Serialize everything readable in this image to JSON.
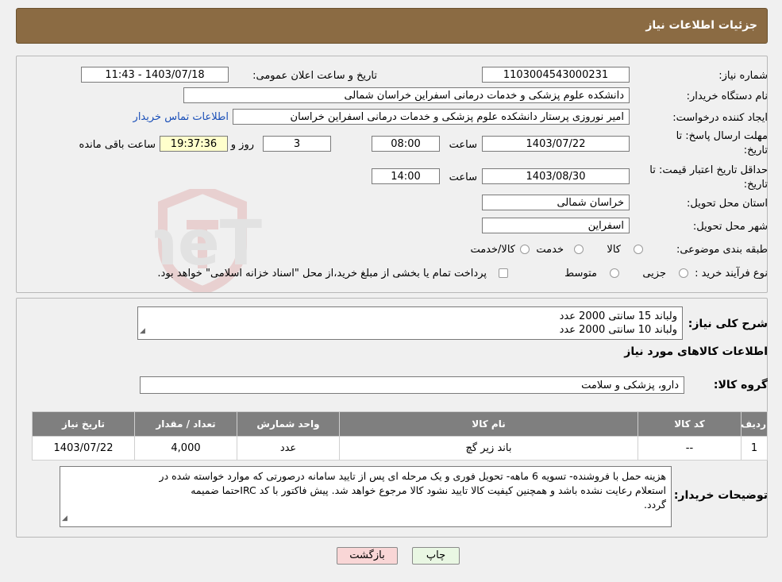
{
  "header": {
    "title": "جزئیات اطلاعات نیاز"
  },
  "need_number": {
    "label": "شماره نیاز:",
    "value": "1103004543000231"
  },
  "announce_datetime": {
    "label": "تاریخ و ساعت اعلان عمومی:",
    "value": "1403/07/18 - 11:43"
  },
  "buyer_org": {
    "label": "نام دستگاه خریدار:",
    "value": "دانشکده علوم پزشکی و خدمات درمانی اسفراین خراسان شمالی"
  },
  "requester": {
    "label": "ایجاد کننده درخواست:",
    "value": "امیر  نوروزی  پرستار  دانشکده علوم پزشکی و خدمات درمانی اسفراین خراسان",
    "contact_link": "اطلاعات تماس خریدار"
  },
  "reply_deadline": {
    "label_line1": "مهلت ارسال پاسخ: تا",
    "label_line2": "تاریخ:",
    "date": "1403/07/22",
    "time_label": "ساعت",
    "time": "08:00",
    "days": "3",
    "days_label": "روز و",
    "remaining": "19:37:36",
    "remaining_label": "ساعت باقی مانده"
  },
  "price_validity": {
    "label_line1": "حداقل تاریخ اعتبار قیمت: تا",
    "label_line2": "تاریخ:",
    "date": "1403/08/30",
    "time_label": "ساعت",
    "time": "14:00"
  },
  "delivery_province": {
    "label": "استان محل تحویل:",
    "value": "خراسان شمالی"
  },
  "delivery_city": {
    "label": "شهر محل تحویل:",
    "value": "اسفراین"
  },
  "category": {
    "label": "طبقه بندی موضوعی:",
    "options": [
      "کالا",
      "خدمت",
      "کالا/خدمت"
    ]
  },
  "purchase_type": {
    "label": "نوع فرآیند خرید :",
    "options": [
      "جزیی",
      "متوسط"
    ],
    "note": "پرداخت تمام یا بخشی از مبلغ خرید،از محل \"اسناد خزانه اسلامی\" خواهد بود."
  },
  "summary": {
    "label": "شرح کلی نیاز:",
    "lines": [
      "ولباند 15 سانتی 2000 عدد",
      "ولباند 10 سانتی 2000 عدد"
    ]
  },
  "goods_info_title": "اطلاعات کالاهای مورد نیاز",
  "goods_group": {
    "label": "گروه کالا:",
    "value": "دارو، پزشکی و سلامت"
  },
  "table": {
    "headers": [
      "ردیف",
      "کد کالا",
      "نام کالا",
      "واحد شمارش",
      "تعداد / مقدار",
      "تاریخ نیاز"
    ],
    "rows": [
      {
        "row": "1",
        "code": "--",
        "name": "باند زیر گچ",
        "unit": "عدد",
        "qty": "4,000",
        "date": "1403/07/22"
      }
    ]
  },
  "buyer_notes": {
    "label": "توضیحات خریدار:",
    "lines": [
      "هزینه حمل با فروشنده- تسویه 6 ماهه- تحویل فوری و یک مرحله ای پس از تایید سامانه درصورتی که موارد خواسته شده در",
      "استعلام رعایت نشده باشد و همچنین کیفیت کالا تایید نشود کالا مرجوع خواهد شد. پیش فاکتور با کد IRCحتما ضمیمه",
      "گردد."
    ]
  },
  "buttons": {
    "print": "چاپ",
    "back": "بازگشت"
  },
  "colors": {
    "header": "#8b6b43",
    "back_button": "#f9d6d6",
    "print_button": "#e9f7e3",
    "table_header": "#7f7f7f"
  }
}
